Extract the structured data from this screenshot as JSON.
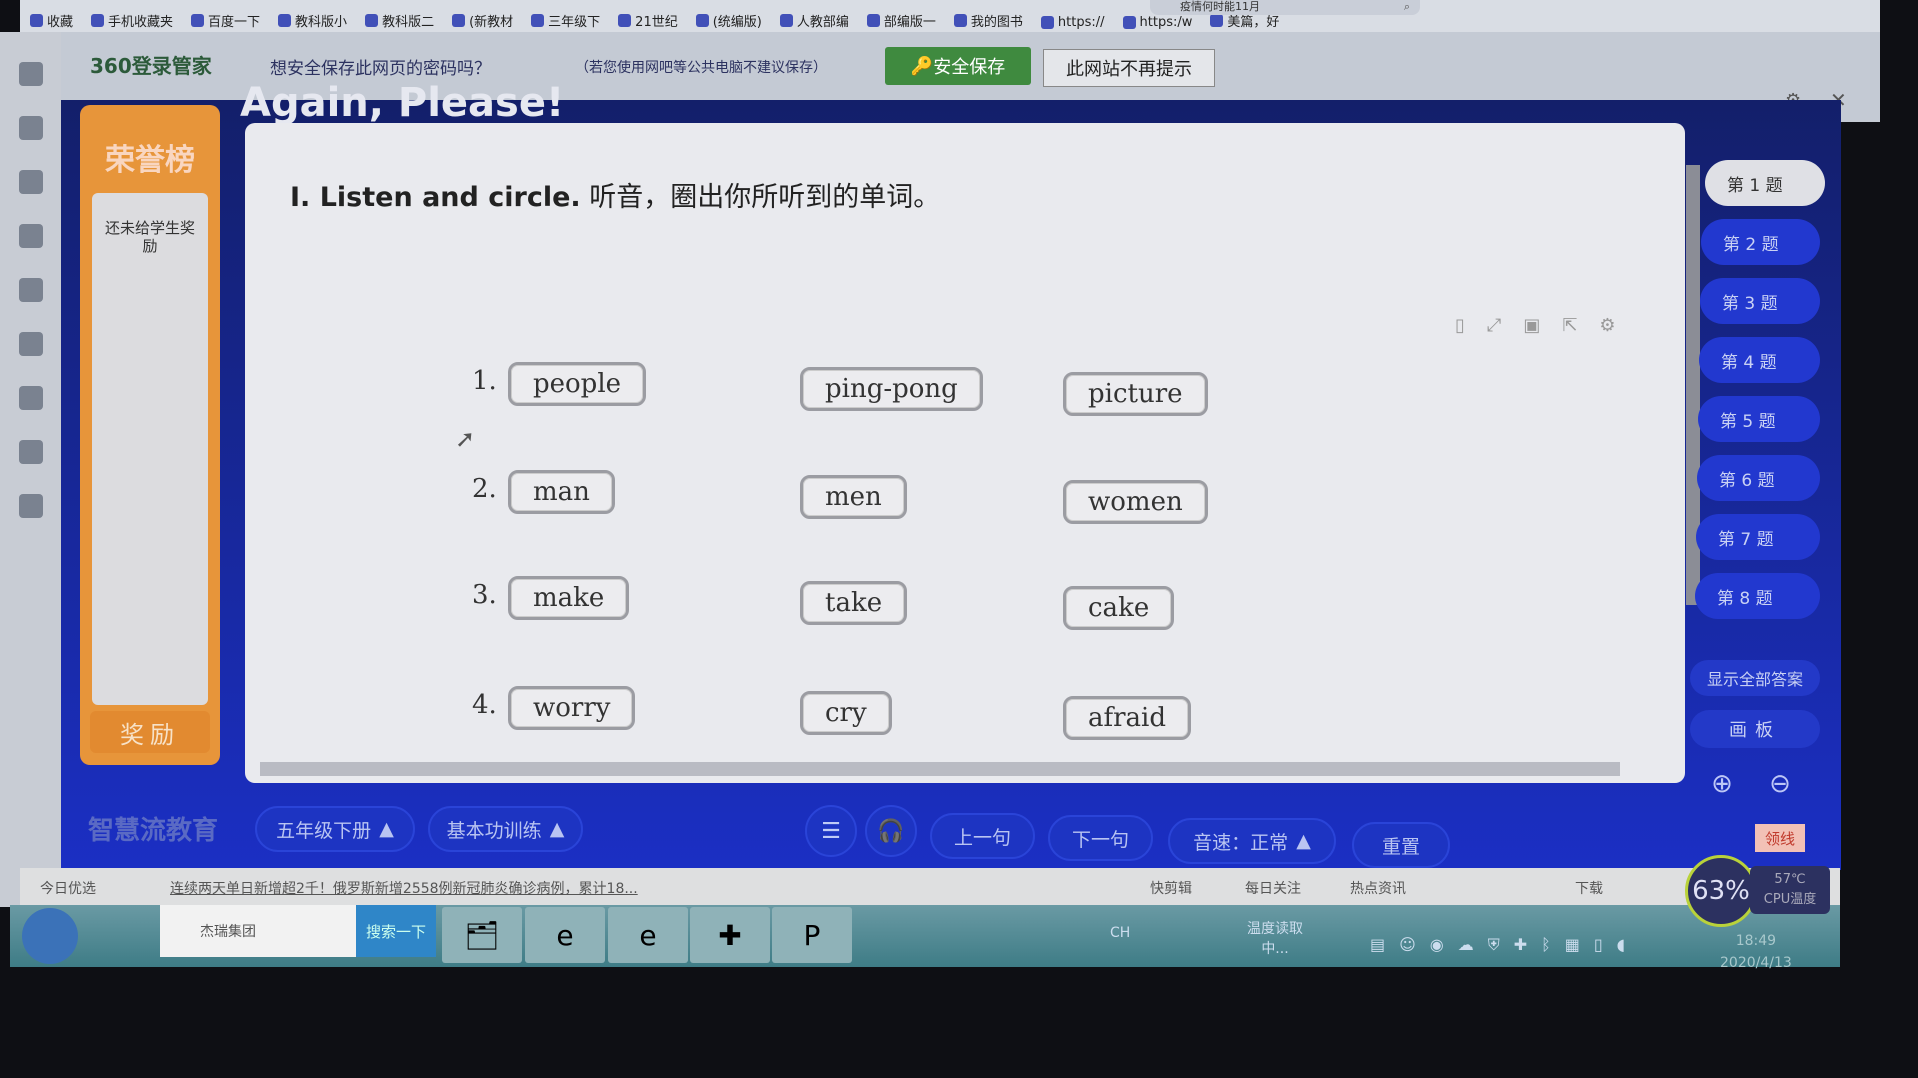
{
  "browser": {
    "bookmarks": [
      "收藏",
      "手机收藏夹",
      "百度一下",
      "教科版小",
      "教科版二",
      "(新教材",
      "三年级下",
      "21世纪",
      "(统编版)",
      "人教部编",
      "部编版一",
      "我的图书",
      "https://",
      "https:/w",
      "美篇，好"
    ],
    "address_partial": "疫情何时能11月",
    "password_bar": {
      "logo": "360登录管家",
      "message": "想安全保存此网页的密码吗？",
      "note": "（若您使用网吧等公共电脑不建议保存）",
      "save_label": "安全保存",
      "never_label": "此网站不再提示"
    }
  },
  "app": {
    "title": "Again, Please!",
    "honor": {
      "title": "荣誉榜",
      "empty_text": "还未给学生奖励",
      "reward_label": "奖励"
    },
    "question": {
      "prefix": "I. Listen and circle.",
      "instruction": "听音，圈出你所听到的单词。"
    },
    "rows": [
      {
        "num": "1.",
        "words": [
          "people",
          "ping-pong",
          "picture"
        ]
      },
      {
        "num": "2.",
        "words": [
          "man",
          "men",
          "women"
        ]
      },
      {
        "num": "3.",
        "words": [
          "make",
          "take",
          "cake"
        ]
      },
      {
        "num": "4.",
        "words": [
          "worry",
          "cry",
          "afraid"
        ]
      }
    ],
    "questions": [
      "第 1 题",
      "第 2 题",
      "第 3 题",
      "第 4 题",
      "第 5 题",
      "第 6 题",
      "第 7 题",
      "第 8 题"
    ],
    "active_question": 0,
    "show_all_label": "显示全部答案",
    "board_label": "画板",
    "toolbar": {
      "brand": "智慧流教育",
      "grade": "五年级下册",
      "module": "基本功训练",
      "prev": "上一句",
      "next": "下一句",
      "speed": "音速：正常",
      "reset": "重置"
    }
  },
  "newsbar": {
    "label": "今日优选",
    "headline": "连续两天单日新增超2千！俄罗斯新增2558例新冠肺炎确诊病例，累计18...",
    "items": [
      "快剪辑",
      "每日关注",
      "热点资讯",
      "下载"
    ]
  },
  "taskbar": {
    "search_text": "杰瑞集团",
    "search_button": "搜索一下",
    "lang": "CH",
    "weather": "温度读取中...",
    "time": "18:49",
    "date": "2020/4/13"
  },
  "cpu": {
    "usage": "63%",
    "temp": "57℃",
    "temp_label": "CPU温度",
    "badge": "领线"
  },
  "colors": {
    "app_blue": "#1b2fc4",
    "honor_orange": "#e7953a",
    "save_green": "#3f8a3f"
  }
}
